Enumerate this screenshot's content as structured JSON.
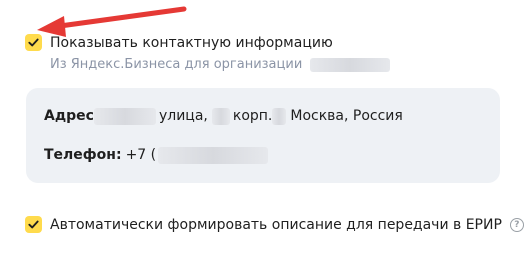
{
  "colors": {
    "checkbox_bg": "#ffdb4d",
    "checkmark": "#1f1f1f",
    "subtext": "#8b94a6",
    "card_bg": "#eef1f5",
    "arrow": "#e53935"
  },
  "show_contact": {
    "checked": true,
    "label": "Показывать контактную информацию",
    "source_text": "Из Яндекс.Бизнеса для организации"
  },
  "contact_card": {
    "address_label": "Адрес",
    "address_street_word": "улица,",
    "address_building_word": "корп.",
    "address_city": "Москва, Россия",
    "phone_label": "Телефон:",
    "phone_prefix": "+7 ("
  },
  "auto_description": {
    "checked": true,
    "label": "Автоматически формировать описание для передачи в ЕРИР",
    "help_icon": "question-circle-icon",
    "help_glyph": "?"
  },
  "annotation": {
    "icon": "red-arrow-pointer-icon"
  }
}
